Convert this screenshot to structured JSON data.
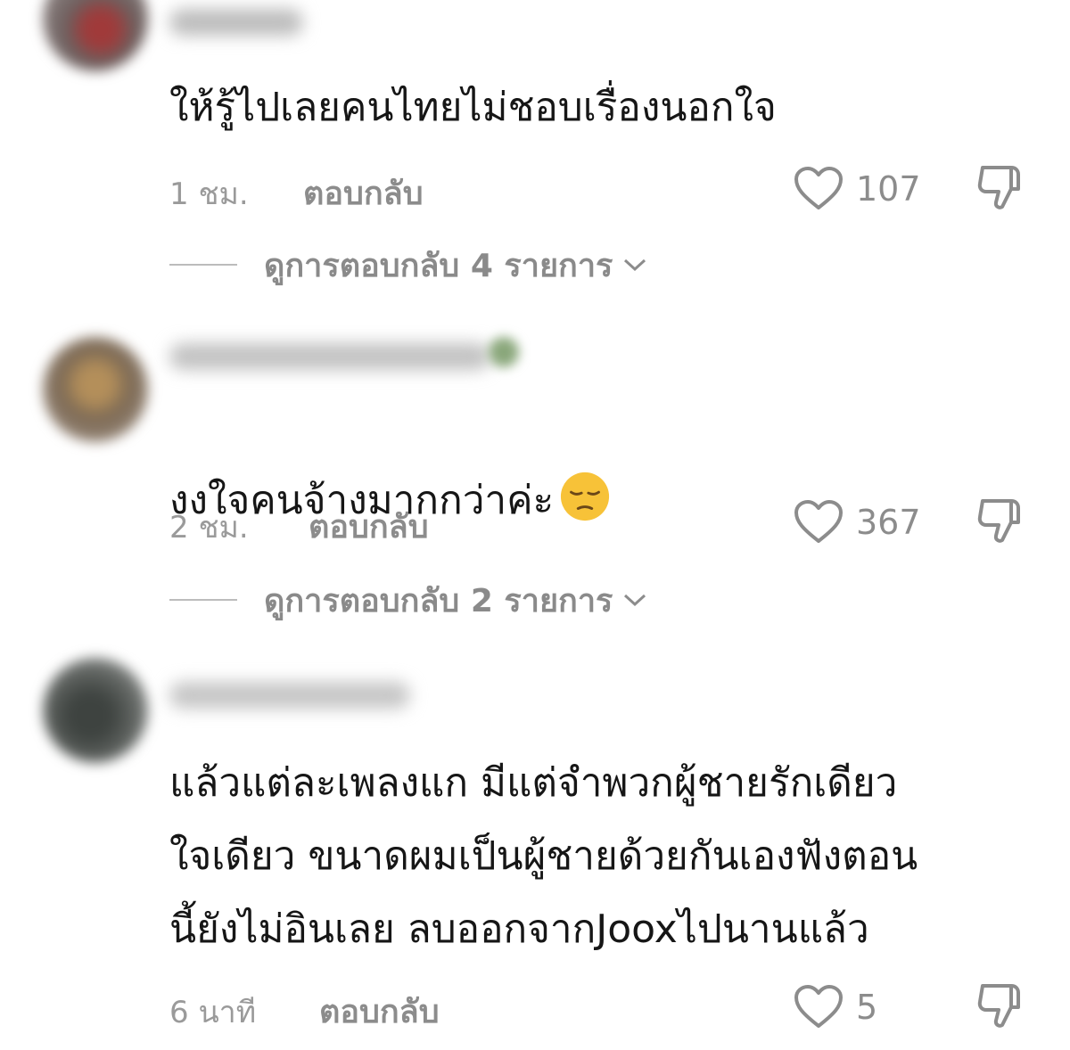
{
  "comments": [
    {
      "text": "ให้รู้ไปเลยคนไทยไม่ชอบเรื่องนอกใจ",
      "time": "1 ชม.",
      "reply_label": "ตอบกลับ",
      "likes": "107",
      "view_replies": "ดูการตอบกลับ 4 รายการ",
      "avatar_color": "#7a5a57"
    },
    {
      "text": "งงใจคนจ้างมากกว่าค่ะ",
      "time": "2 ชม.",
      "reply_label": "ตอบกลับ",
      "likes": "367",
      "view_replies": "ดูการตอบกลับ 2 รายการ",
      "avatar_color": "#8a7760",
      "emoji": "pensive-face"
    },
    {
      "text": "แล้วแต่ละเพลงแก มีแต่จำพวกผู้ชายรักเดียว\nใจเดียว ขนาดผมเป็นผู้ชายด้วยกันเองฟังตอน\nนี้ยังไม่อินเลย ลบออกจากJooxไปนานแล้ว",
      "time": "6 นาที",
      "reply_label": "ตอบกลับ",
      "likes": "5",
      "avatar_color": "#4e5250"
    }
  ],
  "icons": {
    "like": "heart-outline-icon",
    "dislike": "thumbs-down-outline-icon",
    "chevron": "chevron-down-icon"
  }
}
